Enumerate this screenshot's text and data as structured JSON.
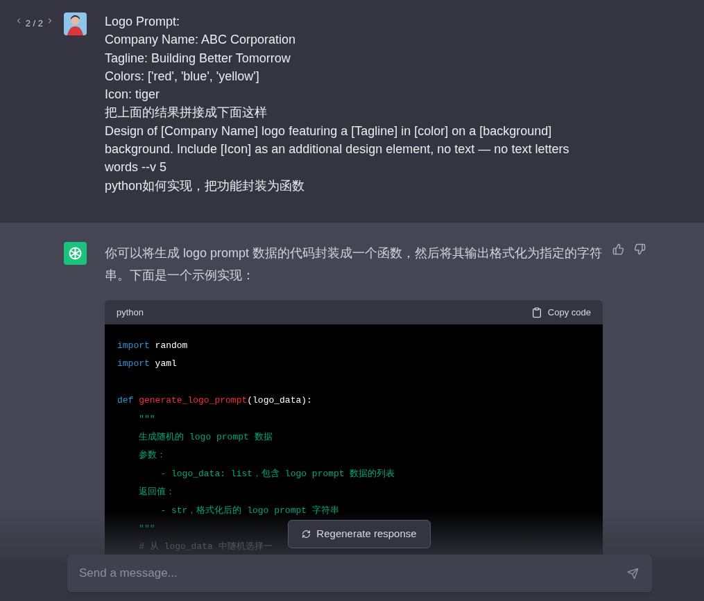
{
  "user_message": {
    "pager": "2 / 2",
    "lines": [
      "Logo Prompt:",
      "Company Name: ABC Corporation",
      "Tagline: Building Better Tomorrow",
      "Colors: ['red', 'blue', 'yellow']",
      "Icon: tiger",
      "把上面的结果拼接成下面这样",
      "Design of [Company Name] logo featuring a [Tagline] in [color] on a [background] background. Include [Icon] as an additional design element, no text — no text letters words --v 5",
      "python如何实现，把功能封装为函数"
    ]
  },
  "assistant_message": {
    "text": "你可以将生成 logo prompt 数据的代码封装成一个函数，然后将其输出格式化为指定的字符串。下面是一个示例实现：",
    "code": {
      "language": "python",
      "copy_label": "Copy code",
      "lines": [
        [
          {
            "text": "import",
            "kind": "keyword"
          },
          {
            "text": " random",
            "kind": "plain"
          }
        ],
        [
          {
            "text": "import",
            "kind": "keyword"
          },
          {
            "text": " yaml",
            "kind": "plain"
          }
        ],
        [
          {
            "kind": "blank"
          }
        ],
        [
          {
            "text": "def ",
            "kind": "keyword"
          },
          {
            "text": "generate_logo_prompt",
            "kind": "function"
          },
          {
            "text": "(logo_data):",
            "kind": "plain"
          }
        ],
        [
          {
            "text": "    \"\"\"",
            "kind": "string"
          }
        ],
        [
          {
            "text": "    生成随机的 logo prompt 数据",
            "kind": "string"
          }
        ],
        [
          {
            "text": "    参数：",
            "kind": "string"
          }
        ],
        [
          {
            "text": "        - logo_data: list，包含 logo prompt 数据的列表",
            "kind": "string"
          }
        ],
        [
          {
            "text": "    返回值：",
            "kind": "string"
          }
        ],
        [
          {
            "text": "        - str，格式化后的 logo prompt 字符串",
            "kind": "string"
          }
        ],
        [
          {
            "text": "    \"\"\"",
            "kind": "string"
          }
        ],
        [
          {
            "text": "    # 从 logo_data 中随机选择一",
            "kind": "comment"
          }
        ]
      ]
    }
  },
  "regenerate_label": "Regenerate response",
  "composer": {
    "placeholder": "Send a message..."
  }
}
